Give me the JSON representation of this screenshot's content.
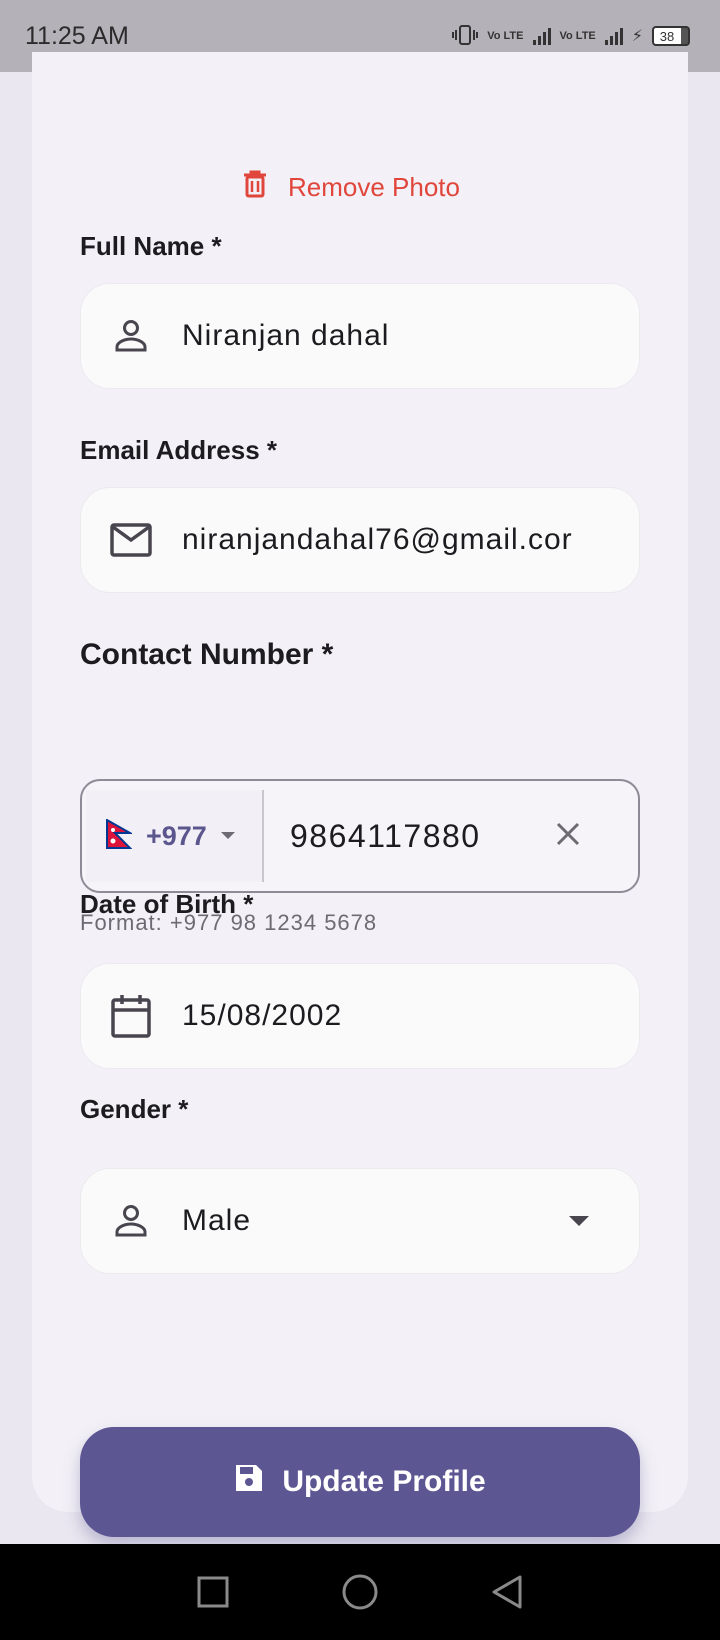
{
  "status_bar": {
    "time": "11:25 AM",
    "volte_1": "Vo LTE",
    "volte_2": "Vo LTE",
    "battery": "38"
  },
  "remove_photo": {
    "label": "Remove Photo",
    "icon": "trash-icon",
    "color": "#E0463C"
  },
  "form": {
    "full_name": {
      "label": "Full Name *",
      "value": "Niranjan dahal",
      "icon": "person-icon"
    },
    "email": {
      "label": "Email Address *",
      "value": "niranjandahal76@gmail.cor",
      "icon": "mail-icon"
    },
    "contact": {
      "label": "Contact Number *",
      "country_flag": "nepal-flag-icon",
      "country_code": "+977",
      "value": "9864117880",
      "hint": "Format: +977 98 1234 5678"
    },
    "dob": {
      "label": "Date of Birth *",
      "value": "15/08/2002",
      "icon": "calendar-icon"
    },
    "gender": {
      "label": "Gender *",
      "value": "Male",
      "icon": "person-icon"
    }
  },
  "update_button": {
    "label": "Update Profile",
    "icon": "save-icon",
    "color": "#5C5793"
  },
  "colors": {
    "accent": "#5C5793",
    "danger": "#E0463C",
    "background": "#EAE7F0",
    "card": "#F3F1F7"
  }
}
